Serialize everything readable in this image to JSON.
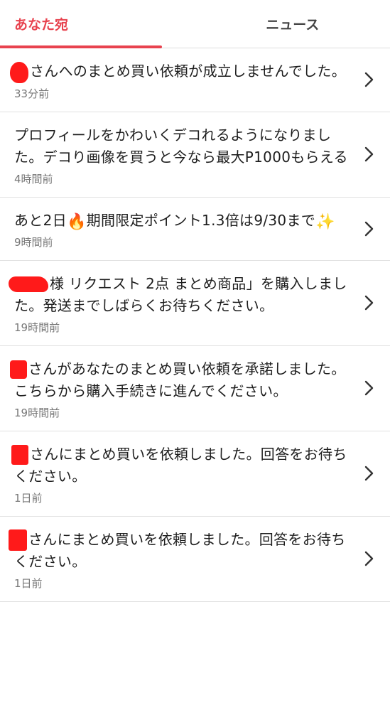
{
  "tabs": {
    "you": "あなた宛",
    "news": "ニュース"
  },
  "notifications": [
    {
      "text": "さんへのまとめ買い依頼が成立しませんでした。",
      "time": "33分前"
    },
    {
      "text": "プロフィールをかわいくデコれるようになりました。デコり画像を買うと今なら最大P1000もらえる",
      "time": "4時間前"
    },
    {
      "text_before": "あと2日",
      "text_middle": "期間限定ポイント1.3倍は9/30まで",
      "time": "9時間前",
      "icons": [
        "fire-emoji",
        "sparkles-emoji"
      ]
    },
    {
      "text": "様 リクエスト 2点 まとめ商品」を購入しました。発送までしばらくお待ちください。",
      "time": "19時間前"
    },
    {
      "text": "さんがあなたのまとめ買い依頼を承諾しました。こちらから購入手続きに進んでください。",
      "time": "19時間前"
    },
    {
      "text": "さんにまとめ買いを依頼しました。回答をお待ちください。",
      "time": "1日前"
    },
    {
      "text": "さんにまとめ買いを依頼しました。回答をお待ちください。",
      "time": "1日前"
    }
  ],
  "colors": {
    "accent": "#e8434f",
    "redaction": "#ff1a1a",
    "divider": "#e1e1e1"
  }
}
